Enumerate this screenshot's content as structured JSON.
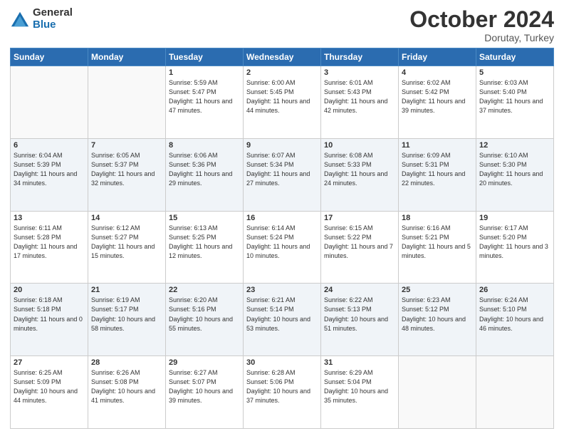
{
  "logo": {
    "general": "General",
    "blue": "Blue"
  },
  "header": {
    "month": "October 2024",
    "location": "Dorutay, Turkey"
  },
  "weekdays": [
    "Sunday",
    "Monday",
    "Tuesday",
    "Wednesday",
    "Thursday",
    "Friday",
    "Saturday"
  ],
  "weeks": [
    [
      {
        "day": "",
        "sunrise": "",
        "sunset": "",
        "daylight": ""
      },
      {
        "day": "",
        "sunrise": "",
        "sunset": "",
        "daylight": ""
      },
      {
        "day": "1",
        "sunrise": "Sunrise: 5:59 AM",
        "sunset": "Sunset: 5:47 PM",
        "daylight": "Daylight: 11 hours and 47 minutes."
      },
      {
        "day": "2",
        "sunrise": "Sunrise: 6:00 AM",
        "sunset": "Sunset: 5:45 PM",
        "daylight": "Daylight: 11 hours and 44 minutes."
      },
      {
        "day": "3",
        "sunrise": "Sunrise: 6:01 AM",
        "sunset": "Sunset: 5:43 PM",
        "daylight": "Daylight: 11 hours and 42 minutes."
      },
      {
        "day": "4",
        "sunrise": "Sunrise: 6:02 AM",
        "sunset": "Sunset: 5:42 PM",
        "daylight": "Daylight: 11 hours and 39 minutes."
      },
      {
        "day": "5",
        "sunrise": "Sunrise: 6:03 AM",
        "sunset": "Sunset: 5:40 PM",
        "daylight": "Daylight: 11 hours and 37 minutes."
      }
    ],
    [
      {
        "day": "6",
        "sunrise": "Sunrise: 6:04 AM",
        "sunset": "Sunset: 5:39 PM",
        "daylight": "Daylight: 11 hours and 34 minutes."
      },
      {
        "day": "7",
        "sunrise": "Sunrise: 6:05 AM",
        "sunset": "Sunset: 5:37 PM",
        "daylight": "Daylight: 11 hours and 32 minutes."
      },
      {
        "day": "8",
        "sunrise": "Sunrise: 6:06 AM",
        "sunset": "Sunset: 5:36 PM",
        "daylight": "Daylight: 11 hours and 29 minutes."
      },
      {
        "day": "9",
        "sunrise": "Sunrise: 6:07 AM",
        "sunset": "Sunset: 5:34 PM",
        "daylight": "Daylight: 11 hours and 27 minutes."
      },
      {
        "day": "10",
        "sunrise": "Sunrise: 6:08 AM",
        "sunset": "Sunset: 5:33 PM",
        "daylight": "Daylight: 11 hours and 24 minutes."
      },
      {
        "day": "11",
        "sunrise": "Sunrise: 6:09 AM",
        "sunset": "Sunset: 5:31 PM",
        "daylight": "Daylight: 11 hours and 22 minutes."
      },
      {
        "day": "12",
        "sunrise": "Sunrise: 6:10 AM",
        "sunset": "Sunset: 5:30 PM",
        "daylight": "Daylight: 11 hours and 20 minutes."
      }
    ],
    [
      {
        "day": "13",
        "sunrise": "Sunrise: 6:11 AM",
        "sunset": "Sunset: 5:28 PM",
        "daylight": "Daylight: 11 hours and 17 minutes."
      },
      {
        "day": "14",
        "sunrise": "Sunrise: 6:12 AM",
        "sunset": "Sunset: 5:27 PM",
        "daylight": "Daylight: 11 hours and 15 minutes."
      },
      {
        "day": "15",
        "sunrise": "Sunrise: 6:13 AM",
        "sunset": "Sunset: 5:25 PM",
        "daylight": "Daylight: 11 hours and 12 minutes."
      },
      {
        "day": "16",
        "sunrise": "Sunrise: 6:14 AM",
        "sunset": "Sunset: 5:24 PM",
        "daylight": "Daylight: 11 hours and 10 minutes."
      },
      {
        "day": "17",
        "sunrise": "Sunrise: 6:15 AM",
        "sunset": "Sunset: 5:22 PM",
        "daylight": "Daylight: 11 hours and 7 minutes."
      },
      {
        "day": "18",
        "sunrise": "Sunrise: 6:16 AM",
        "sunset": "Sunset: 5:21 PM",
        "daylight": "Daylight: 11 hours and 5 minutes."
      },
      {
        "day": "19",
        "sunrise": "Sunrise: 6:17 AM",
        "sunset": "Sunset: 5:20 PM",
        "daylight": "Daylight: 11 hours and 3 minutes."
      }
    ],
    [
      {
        "day": "20",
        "sunrise": "Sunrise: 6:18 AM",
        "sunset": "Sunset: 5:18 PM",
        "daylight": "Daylight: 11 hours and 0 minutes."
      },
      {
        "day": "21",
        "sunrise": "Sunrise: 6:19 AM",
        "sunset": "Sunset: 5:17 PM",
        "daylight": "Daylight: 10 hours and 58 minutes."
      },
      {
        "day": "22",
        "sunrise": "Sunrise: 6:20 AM",
        "sunset": "Sunset: 5:16 PM",
        "daylight": "Daylight: 10 hours and 55 minutes."
      },
      {
        "day": "23",
        "sunrise": "Sunrise: 6:21 AM",
        "sunset": "Sunset: 5:14 PM",
        "daylight": "Daylight: 10 hours and 53 minutes."
      },
      {
        "day": "24",
        "sunrise": "Sunrise: 6:22 AM",
        "sunset": "Sunset: 5:13 PM",
        "daylight": "Daylight: 10 hours and 51 minutes."
      },
      {
        "day": "25",
        "sunrise": "Sunrise: 6:23 AM",
        "sunset": "Sunset: 5:12 PM",
        "daylight": "Daylight: 10 hours and 48 minutes."
      },
      {
        "day": "26",
        "sunrise": "Sunrise: 6:24 AM",
        "sunset": "Sunset: 5:10 PM",
        "daylight": "Daylight: 10 hours and 46 minutes."
      }
    ],
    [
      {
        "day": "27",
        "sunrise": "Sunrise: 6:25 AM",
        "sunset": "Sunset: 5:09 PM",
        "daylight": "Daylight: 10 hours and 44 minutes."
      },
      {
        "day": "28",
        "sunrise": "Sunrise: 6:26 AM",
        "sunset": "Sunset: 5:08 PM",
        "daylight": "Daylight: 10 hours and 41 minutes."
      },
      {
        "day": "29",
        "sunrise": "Sunrise: 6:27 AM",
        "sunset": "Sunset: 5:07 PM",
        "daylight": "Daylight: 10 hours and 39 minutes."
      },
      {
        "day": "30",
        "sunrise": "Sunrise: 6:28 AM",
        "sunset": "Sunset: 5:06 PM",
        "daylight": "Daylight: 10 hours and 37 minutes."
      },
      {
        "day": "31",
        "sunrise": "Sunrise: 6:29 AM",
        "sunset": "Sunset: 5:04 PM",
        "daylight": "Daylight: 10 hours and 35 minutes."
      },
      {
        "day": "",
        "sunrise": "",
        "sunset": "",
        "daylight": ""
      },
      {
        "day": "",
        "sunrise": "",
        "sunset": "",
        "daylight": ""
      }
    ]
  ]
}
